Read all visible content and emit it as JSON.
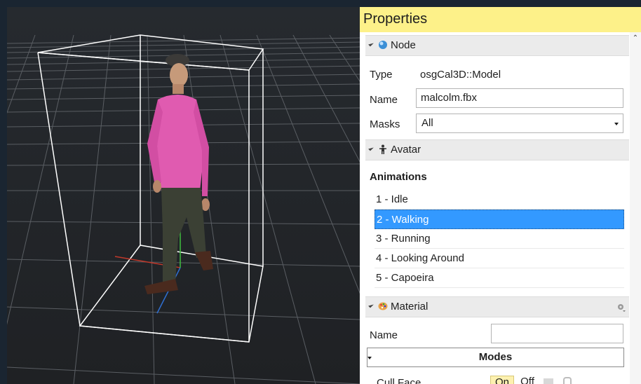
{
  "panel": {
    "title": "Properties",
    "node_section": {
      "label": "Node",
      "icon": "node-sphere-icon"
    },
    "type": {
      "label": "Type",
      "value": "osgCal3D::Model"
    },
    "name": {
      "label": "Name",
      "value": "malcolm.fbx"
    },
    "masks": {
      "label": "Masks",
      "value": "All"
    },
    "avatar_section": {
      "label": "Avatar",
      "icon": "person-icon"
    },
    "animations": {
      "heading": "Animations",
      "items": [
        "1 - Idle",
        "2 - Walking",
        "3 - Running",
        "4 - Looking Around",
        "5 - Capoeira"
      ],
      "selected_index": 1
    },
    "material_section": {
      "label": "Material",
      "icon": "palette-icon"
    },
    "material_name": {
      "label": "Name",
      "value": ""
    },
    "modes": {
      "value": "Modes"
    },
    "cull_face": {
      "label": "Cull Face",
      "on_label": "On",
      "off_label": "Off"
    }
  },
  "colors": {
    "panel_title_bg": "#fdf189",
    "selection": "#3399ff",
    "viewport_bg": "#222428"
  }
}
